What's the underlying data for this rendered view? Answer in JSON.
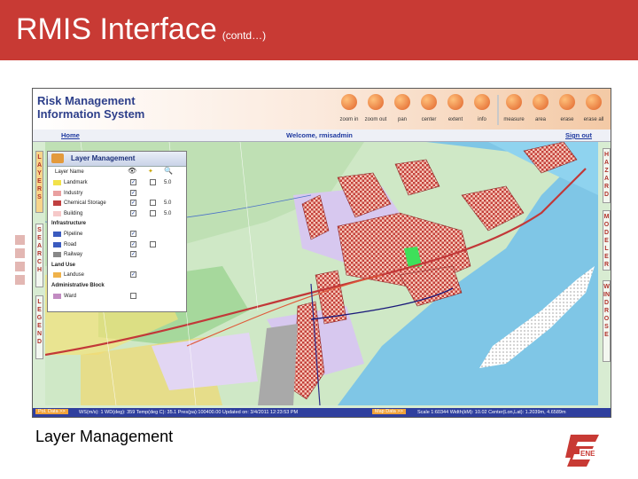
{
  "slide": {
    "title": "RMIS Interface",
    "title_suffix": "(contd…)",
    "caption": "Layer Management",
    "header_color": "#c83a34"
  },
  "app": {
    "title_line1": "Risk Management",
    "title_line2": "Information System",
    "toolbar": [
      {
        "label": "zoom in",
        "icon": "zoom-in-icon"
      },
      {
        "label": "zoom out",
        "icon": "zoom-out-icon"
      },
      {
        "label": "pan",
        "icon": "pan-icon"
      },
      {
        "label": "center",
        "icon": "center-icon"
      },
      {
        "label": "extent",
        "icon": "extent-icon"
      },
      {
        "label": "info",
        "icon": "info-icon"
      },
      {
        "label": "measure",
        "icon": "measure-icon"
      },
      {
        "label": "area",
        "icon": "area-icon"
      },
      {
        "label": "erase",
        "icon": "erase-icon"
      },
      {
        "label": "erase all",
        "icon": "erase-all-icon"
      }
    ],
    "nav": {
      "home": "Home",
      "welcome": "Welcome, rmisadmin",
      "signout": "Sign out"
    },
    "left_tabs": [
      "LAYERS",
      "SEARCH",
      "LEGEND"
    ],
    "right_tabs": [
      "HAZARD",
      "MODELER",
      "WIND ROSE"
    ],
    "layer_panel": {
      "title": "Layer Management",
      "col_layer_name": "Layer Name",
      "rows": [
        {
          "type": "layer",
          "label": "Landmark",
          "swatch": "#f2e24a",
          "visible": true,
          "selectable": true,
          "value": "5.0"
        },
        {
          "type": "layer",
          "label": "Industry",
          "swatch": "#e9a0a0",
          "visible": true,
          "selectable": false,
          "value": ""
        },
        {
          "type": "layer",
          "label": "Chemical Storage",
          "swatch": "#c04040",
          "visible": true,
          "selectable": true,
          "value": "5.0"
        },
        {
          "type": "layer",
          "label": "Building",
          "swatch": "#f6c9c9",
          "visible": true,
          "selectable": true,
          "value": "5.0"
        },
        {
          "type": "group",
          "label": "Infrastructure"
        },
        {
          "type": "layer",
          "label": "Pipeline",
          "swatch": "#3a5bbf",
          "visible": true,
          "selectable": false,
          "value": ""
        },
        {
          "type": "layer",
          "label": "Road",
          "swatch": "#3a5bbf",
          "visible": true,
          "selectable": true,
          "value": ""
        },
        {
          "type": "layer",
          "label": "Railway",
          "swatch": "#888888",
          "visible": true,
          "selectable": false,
          "value": ""
        },
        {
          "type": "group",
          "label": "Land Use"
        },
        {
          "type": "layer",
          "label": "Landuse",
          "swatch": "#f0b24a",
          "visible": true,
          "selectable": false,
          "value": ""
        },
        {
          "type": "group",
          "label": "Administrative Block"
        },
        {
          "type": "layer",
          "label": "Ward",
          "swatch": "#c28cc2",
          "visible": false,
          "selectable": false,
          "value": ""
        }
      ]
    },
    "statusbar": {
      "left_label": "Pol. Data >>",
      "left_text": "WS(m/s): 1   WD(deg): 359   Temp(deg C): 35.1   Pres(pa):100400.00   Updated on: 3/4/2011 12:23:53 PM",
      "right_label": "Map Data >>",
      "right_text": "Scale 1:60344   Width(kM): 10.02   Center(Lon,Lat): 1.2039m, 4.6589m"
    }
  },
  "colors": {
    "app_title": "#2d3f8a",
    "tab_text": "#b0322a",
    "statusbar": "#2f3f9e"
  }
}
